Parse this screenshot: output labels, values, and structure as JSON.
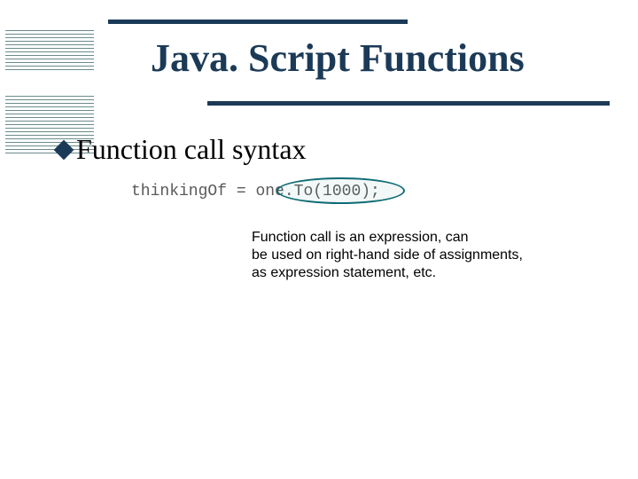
{
  "title": "Java. Script Functions",
  "bullet": {
    "text": "Function call syntax"
  },
  "code": {
    "lhs": "thinkingOf",
    "eq": " = ",
    "rhs": "one.To(1000);"
  },
  "annotation": {
    "line1": "Function call is an expression, can",
    "line2": "be used on right-hand side of assignments,",
    "line3": "as expression statement, etc."
  }
}
